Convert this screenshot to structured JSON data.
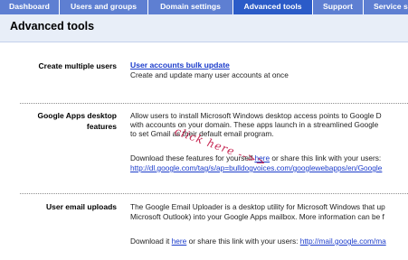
{
  "nav": {
    "tabs": [
      {
        "label": "Dashboard",
        "active": false
      },
      {
        "label": "Users and groups",
        "active": false
      },
      {
        "label": "Domain settings",
        "active": false
      },
      {
        "label": "Advanced tools",
        "active": true
      },
      {
        "label": "Support",
        "active": false
      },
      {
        "label": "Service s",
        "active": false
      }
    ]
  },
  "header": {
    "title": "Advanced tools"
  },
  "sections": {
    "multiple_users": {
      "label": "Create multiple users",
      "link": "User accounts bulk update",
      "description": "Create and update many user accounts at once"
    },
    "desktop": {
      "label_line1": "Google Apps desktop",
      "label_line2": "features",
      "line1": "Allow users to install Microsoft Windows desktop access points to Google D",
      "line2": "with accounts on your domain. These apps launch in a streamlined Google",
      "line3": "to set Gmail as their default email program.",
      "download_pre": "Download these features for yourself",
      "download_link": "here",
      "download_post": "or share this link with your users:",
      "share_url": "http://dl.google.com/tag/s/ap=bulldogvoices.com/googlewebapps/en/Google"
    },
    "uploads": {
      "label": "User email uploads",
      "line1": "The Google Email Uploader is a desktop utility for Microsoft Windows that up",
      "line2": "Microsoft Outlook) into your Google Apps mailbox. More information can be f",
      "download_pre": "Download it",
      "download_link": "here",
      "download_mid": "or share this link with your users:",
      "share_url": "http://mail.google.com/ma"
    }
  },
  "annotation": {
    "text": "click here -->>"
  },
  "colors": {
    "tab_bg": "#5e7fd2",
    "tab_active_bg": "#2b5bc8",
    "header_bg": "#e8eef8",
    "link": "#1a3bcb",
    "annotation": "#c01040"
  }
}
